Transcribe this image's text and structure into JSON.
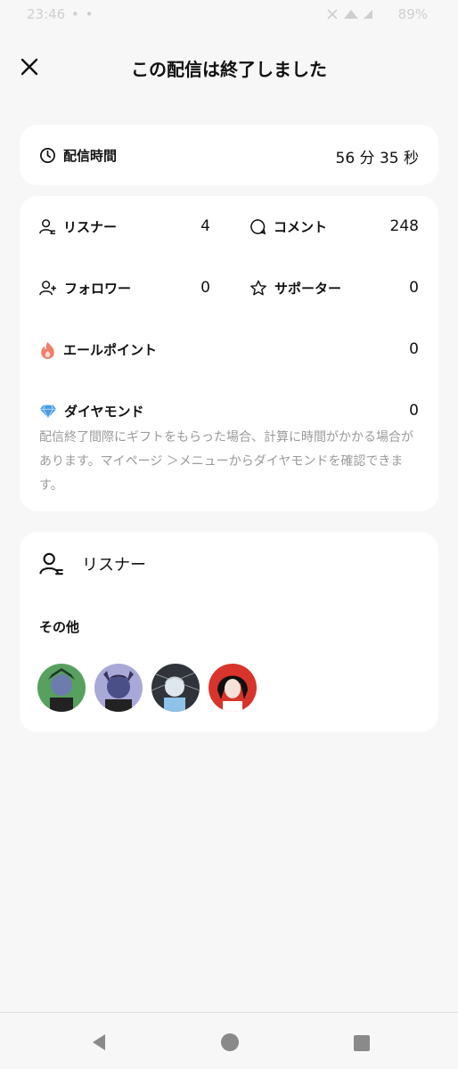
{
  "status_bar": {
    "time": "23:46",
    "dots": "• •",
    "battery": "89%"
  },
  "header": {
    "title": "この配信は終了しました"
  },
  "duration": {
    "label": "配信時間",
    "value": "56 分 35 秒"
  },
  "stats": {
    "listeners": {
      "label": "リスナー",
      "value": "4"
    },
    "comments": {
      "label": "コメント",
      "value": "248"
    },
    "followers": {
      "label": "フォロワー",
      "value": "0"
    },
    "supporters": {
      "label": "サポーター",
      "value": "0"
    },
    "yell_points": {
      "label": "エールポイント",
      "value": "0"
    },
    "diamonds": {
      "label": "ダイヤモンド",
      "value": "0"
    },
    "note": "配信終了間際にギフトをもらった場合、計算に時間がかかる場合があります。マイページ ＞メニューからダイヤモンドを確認できます。"
  },
  "listeners_section": {
    "title": "リスナー",
    "others_label": "その他",
    "avatars": [
      {
        "name": "avatar-1",
        "color": "#4f8a5a"
      },
      {
        "name": "avatar-2",
        "color": "#5a5f8f"
      },
      {
        "name": "avatar-3",
        "color": "#b9c7d6"
      },
      {
        "name": "avatar-4",
        "color": "#d43a2f"
      }
    ]
  },
  "colors": {
    "background": "#f7f7f7",
    "card": "#ffffff",
    "note_text": "#9a9a9a",
    "flame": "#f07f6a",
    "diamond": "#4a9be0"
  },
  "icons": {
    "close": "close-icon",
    "clock": "clock-icon",
    "person": "person-icon",
    "comment": "comment-icon",
    "add_person": "add-person-icon",
    "star": "star-icon",
    "flame": "flame-icon",
    "diamond": "diamond-icon"
  }
}
